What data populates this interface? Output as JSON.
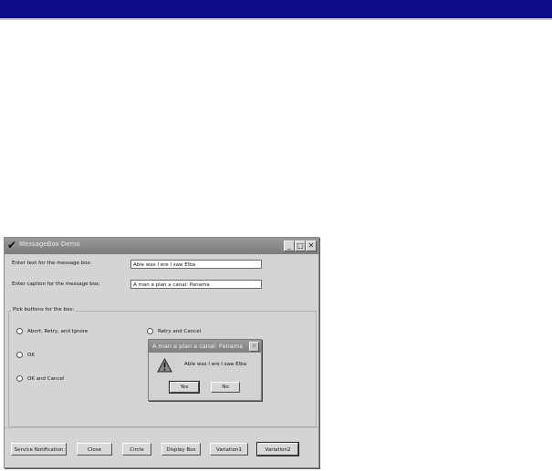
{
  "window": {
    "title": "MessageBox Demo",
    "controls": {
      "minimize": "_",
      "maximize": "□",
      "close": "✕"
    }
  },
  "form": {
    "text_label": "Enter text for the message box:",
    "text_value": "Able was I ere I saw Elba",
    "caption_label": "Enter caption for the message box:",
    "caption_value": "A man a plan a canal: Panama",
    "group_label": "Pick buttons for the box:",
    "options": [
      "Abort, Retry, and Ignore",
      "OK",
      "OK and Cancel",
      "Retry and Cancel"
    ]
  },
  "buttons": {
    "service_notification": "Service Notification",
    "close": "Close",
    "circle": "Circle",
    "display_box": "Display Box",
    "variation1": "Variation1",
    "variation2": "Variation2"
  },
  "dialog": {
    "title": "A man a plan a canal: Panama",
    "icon": "warning-icon",
    "message": "Able was I ere I saw Elba",
    "yes": "Yes",
    "no": "No",
    "close": "✕"
  },
  "colors": {
    "top_bar": "#0c0c88",
    "window_bg": "#d4d4d4",
    "titlebar": "#8a8a8a"
  }
}
